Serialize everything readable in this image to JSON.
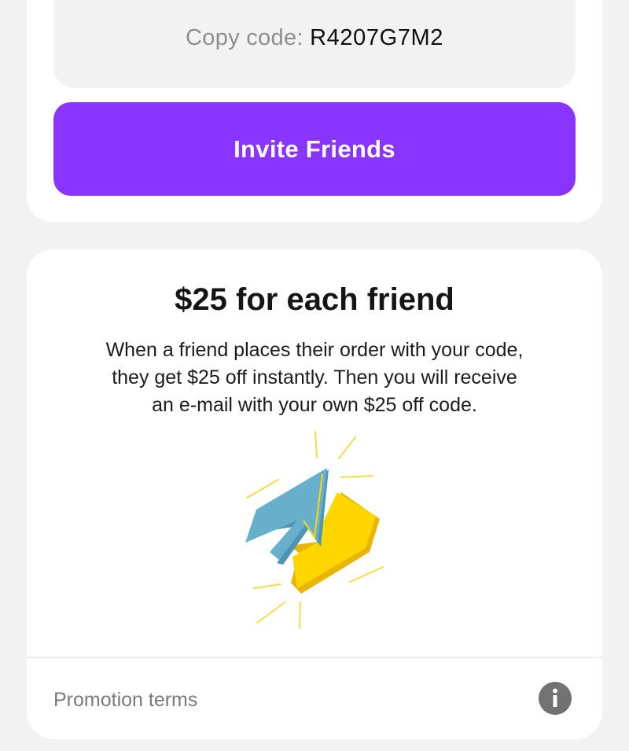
{
  "referral": {
    "code_label": "Copy code:",
    "code_value": "R4207G7M2",
    "invite_button_label": "Invite Friends",
    "accent_color": "#8a35ff"
  },
  "info": {
    "title": "$25 for each friend",
    "description_lines": [
      "When a friend places their order with your code,",
      "they get $25 off instantly. Then you will receive",
      "an e-mail with your own $25 off code."
    ],
    "illustration": "up-down-arrows-illustration",
    "illustration_colors": {
      "up_arrow": "#67afcb",
      "down_arrow": "#ffd400",
      "burst_lines": "#f6dd45"
    }
  },
  "footer": {
    "promotion_terms_label": "Promotion terms",
    "info_icon": "info-icon"
  }
}
